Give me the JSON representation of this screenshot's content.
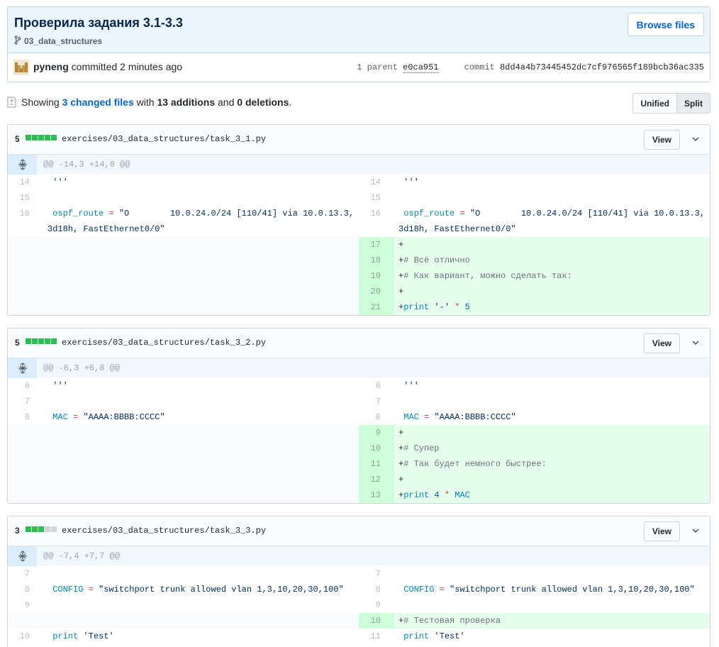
{
  "commit": {
    "title": "Проверила задания 3.1-3.3",
    "branch": "03_data_structures",
    "browse_label": "Browse files",
    "author": "pyneng",
    "action": " committed 2 minutes ago",
    "parent_label": "1 parent",
    "parent_sha": "e0ca951",
    "commit_label": "commit",
    "commit_sha": "8dd4a4b73445452dc7cf976565f189bcb36ac335"
  },
  "toc": {
    "showing": "Showing ",
    "changed_files": "3 changed files",
    "with": " with ",
    "additions": "13 additions",
    "and": " and ",
    "deletions": "0 deletions",
    "period": ".",
    "unified_label": "Unified",
    "split_label": "Split"
  },
  "files": [
    {
      "count": "5",
      "blocks": [
        "add",
        "add",
        "add",
        "add",
        "add"
      ],
      "path": "exercises/03_data_structures/task_3_1.py",
      "view_label": "View",
      "hunk": "@@ -14,3 +14,8 @@",
      "rows": [
        {
          "type": "ctx",
          "l": "14",
          "r": "14",
          "code": " '''"
        },
        {
          "type": "ctx",
          "l": "15",
          "r": "15",
          "code": ""
        },
        {
          "type": "ctx",
          "l": "16",
          "r": "16",
          "code": " ospf_route = \"O        10.0.24.0/24 [110/41] via 10.0.13.3, 3d18h, FastEthernet0/0\""
        },
        {
          "type": "add",
          "r": "17",
          "code": "+"
        },
        {
          "type": "add",
          "r": "18",
          "code": "+# Всё отлично"
        },
        {
          "type": "add",
          "r": "19",
          "code": "+# Как вариант, можно сделать так:"
        },
        {
          "type": "add",
          "r": "20",
          "code": "+"
        },
        {
          "type": "add",
          "r": "21",
          "code": "+print '-' * 5"
        }
      ]
    },
    {
      "count": "5",
      "blocks": [
        "add",
        "add",
        "add",
        "add",
        "add"
      ],
      "path": "exercises/03_data_structures/task_3_2.py",
      "view_label": "View",
      "hunk": "@@ -6,3 +6,8 @@",
      "rows": [
        {
          "type": "ctx",
          "l": "6",
          "r": "6",
          "code": " '''"
        },
        {
          "type": "ctx",
          "l": "7",
          "r": "7",
          "code": ""
        },
        {
          "type": "ctx",
          "l": "8",
          "r": "8",
          "code": " MAC = \"AAAA:BBBB:CCCC\""
        },
        {
          "type": "add",
          "r": "9",
          "code": "+"
        },
        {
          "type": "add",
          "r": "10",
          "code": "+# Супер"
        },
        {
          "type": "add",
          "r": "11",
          "code": "+# Так будет немного быстрее:"
        },
        {
          "type": "add",
          "r": "12",
          "code": "+"
        },
        {
          "type": "add",
          "r": "13",
          "code": "+print 4 * MAC"
        }
      ]
    },
    {
      "count": "3",
      "blocks": [
        "add",
        "add",
        "add",
        "neu",
        "neu"
      ],
      "path": "exercises/03_data_structures/task_3_3.py",
      "view_label": "View",
      "hunk": "@@ -7,4 +7,7 @@",
      "rows": [
        {
          "type": "ctx",
          "l": "7",
          "r": "7",
          "code": ""
        },
        {
          "type": "ctx",
          "l": "8",
          "r": "8",
          "code": " CONFIG = \"switchport trunk allowed vlan 1,3,10,20,30,100\""
        },
        {
          "type": "ctx",
          "l": "9",
          "r": "9",
          "code": ""
        },
        {
          "type": "add",
          "r": "10",
          "code": "+# Тестовая проверка"
        },
        {
          "type": "ctx",
          "l": "10",
          "r": "11",
          "code": " print 'Test'"
        }
      ]
    }
  ]
}
